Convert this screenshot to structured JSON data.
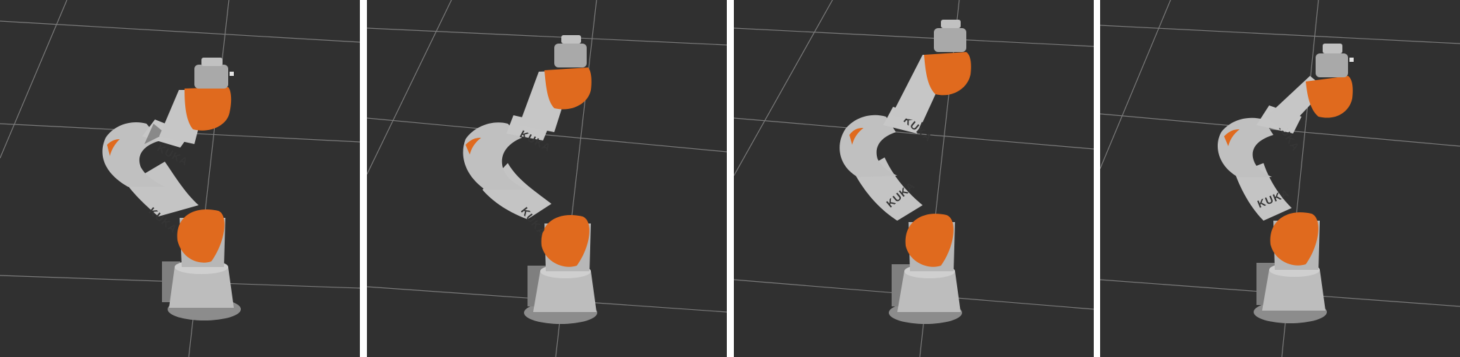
{
  "figure": {
    "panels": [
      {
        "id": "pose-1",
        "branding": "KUKA"
      },
      {
        "id": "pose-2",
        "branding": "KUKA"
      },
      {
        "id": "pose-3",
        "branding": "KUKA"
      },
      {
        "id": "pose-4",
        "branding": "KUKA"
      }
    ]
  },
  "colors": {
    "background": "#303030",
    "grid_line": "#8e8e8e",
    "robot_body": "#b9b9b9",
    "robot_accent": "#e06a1e",
    "separator": "#ffffff"
  },
  "icons": [
    "robot-arm-icon"
  ]
}
